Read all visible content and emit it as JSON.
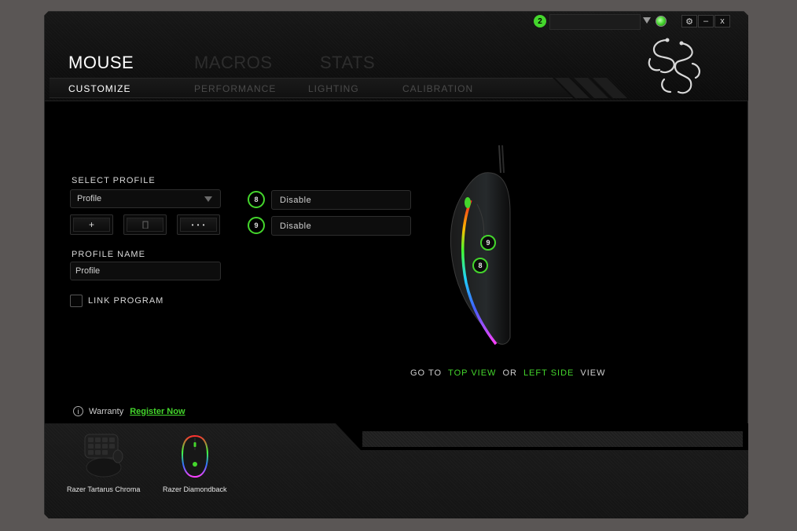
{
  "topbar": {
    "notification_count": "2",
    "window_buttons": [
      "⚙",
      "–",
      "x"
    ]
  },
  "main_tabs": [
    {
      "label": "MOUSE",
      "active": true
    },
    {
      "label": "MACROS",
      "active": false
    },
    {
      "label": "STATS",
      "active": false
    }
  ],
  "sub_tabs": [
    {
      "label": "CUSTOMIZE",
      "active": true
    },
    {
      "label": "PERFORMANCE",
      "active": false
    },
    {
      "label": "LIGHTING",
      "active": false
    },
    {
      "label": "CALIBRATION",
      "active": false
    }
  ],
  "profile": {
    "select_label": "SELECT PROFILE",
    "selected": "Profile",
    "add_button": "+",
    "more_button": "• • •",
    "name_label": "PROFILE NAME",
    "name_value": "Profile",
    "link_program_label": "LINK PROGRAM",
    "link_program_checked": false
  },
  "mapping": [
    {
      "button": "8",
      "action": "Disable"
    },
    {
      "button": "9",
      "action": "Disable"
    }
  ],
  "mouse_view": {
    "button_markers": [
      "9",
      "8"
    ],
    "goto_prefix": "GO TO",
    "top_view_link": "TOP VIEW",
    "or_text": "OR",
    "left_side_link": "LEFT SIDE",
    "view_suffix": "VIEW"
  },
  "warranty": {
    "label": "Warranty",
    "link": "Register Now"
  },
  "devices": [
    {
      "name": "Razer Tartarus Chroma"
    },
    {
      "name": "Razer Diamondback"
    }
  ],
  "colors": {
    "accent": "#44d62c",
    "background": "#000000"
  }
}
